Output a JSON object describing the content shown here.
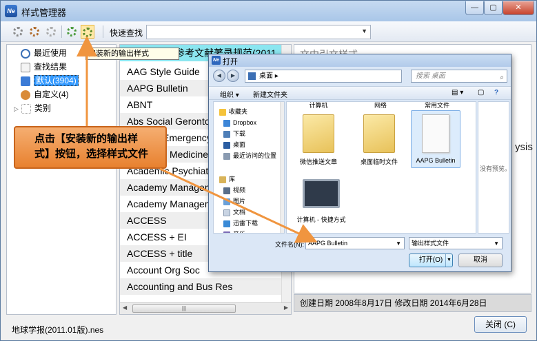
{
  "window": {
    "title": "样式管理器",
    "app_icon_text": "Ne",
    "minimize": "—",
    "maximize": "▢",
    "close": "✕"
  },
  "toolbar": {
    "quick_search_label": "快速查找",
    "quick_search_value": "",
    "tooltip": "安装新的输出样式"
  },
  "tree": {
    "items": [
      {
        "label": "最近使用",
        "icon": "clock-icon"
      },
      {
        "label": "查找结果",
        "icon": "search-icon"
      },
      {
        "label": "默认(3904)",
        "icon": "book-icon",
        "selected": true
      },
      {
        "label": "自定义(4)",
        "icon": "user-icon"
      },
      {
        "label": "类别",
        "icon": "category-icon"
      }
    ]
  },
  "styles": [
    "地球学报》参考文献著录规范(2011",
    "AAG Style Guide",
    "AAPG Bulletin",
    "ABNT",
    "Abs Social Geronto",
    "Emergency M",
    "Medicine",
    "Academic Psychiatr",
    "Academy Managem",
    "Academy Managem",
    "ACCESS",
    "ACCESS + EI",
    "ACCESS + title",
    "Account Org Soc",
    "Accounting and Bus Res"
  ],
  "preview": {
    "heading": "文中引文样式",
    "fragment": "ysis"
  },
  "info": {
    "created_label": "创建日期",
    "created": "2008年8月17日",
    "modified_label": "修改日期",
    "modified": "2014年6月28日"
  },
  "status": {
    "file": "地球学报(2011.01版).nes",
    "close_button": "关闭 (C)"
  },
  "callout": {
    "line1": "点击【安装新的输出样",
    "line2": "式】按钮，选择样式文件"
  },
  "dialog": {
    "title": "打开",
    "address": "桌面 ▸",
    "search_placeholder": "搜索 桌面",
    "organize": "组织 ▾",
    "new_folder": "新建文件夹",
    "sidebar": [
      "收藏夹",
      "Dropbox",
      "下载",
      "桌面",
      "最近访问的位置",
      "库",
      "视频",
      "图片",
      "文档",
      "迅雷下载",
      "音乐"
    ],
    "column_labels": [
      "计算机",
      "网络",
      "常用文件"
    ],
    "files": [
      "微信推送文章",
      "桌面临时文件",
      "AAPG Bulletin",
      "计算机 - 快捷方式"
    ],
    "no_preview": "没有预览。",
    "filename_label": "文件名(N):",
    "filename_value": "AAPG Bulletin",
    "filetype": "输出样式文件",
    "open_button": "打开(O)",
    "cancel_button": "取消"
  },
  "colors": {
    "accent": "#3399ff",
    "selected_row": "#8be6f0",
    "callout": "#e8812f",
    "arrow": "#f0953f"
  }
}
